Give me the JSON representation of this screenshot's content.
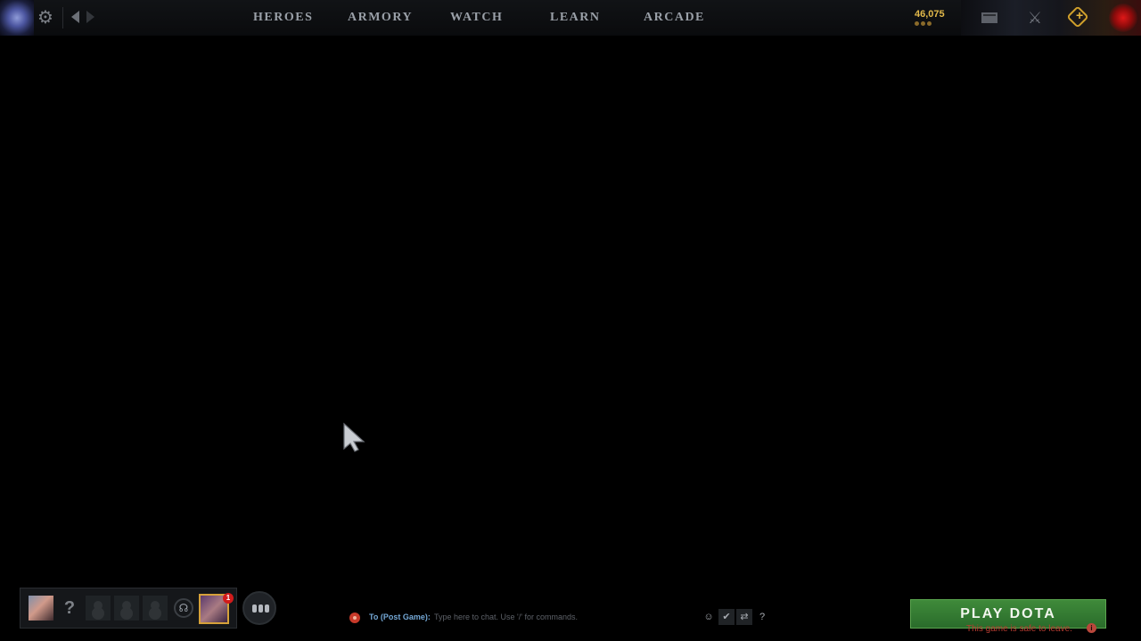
{
  "topbar": {
    "nav": [
      "HEROES",
      "ARMORY",
      "WATCH",
      "LEARN",
      "ARCADE"
    ],
    "shards": "46,075",
    "icons": {
      "dashboard": "dota-dashboard-icon",
      "settings": "gear-icon",
      "back": "chevron-left-icon",
      "forward": "chevron-right-icon",
      "mail": "mail-icon",
      "armory": "armory-icon",
      "plus": "plus-icon"
    }
  },
  "party": {
    "help_glyph": "?",
    "friend_badge": "1",
    "voice_glyph": "☊"
  },
  "chat": {
    "to_label": "To (Post Game):",
    "placeholder": "Type here to chat. Use '/' for commands.",
    "tools": [
      "☺",
      "✔",
      "⇄",
      "?"
    ]
  },
  "play": {
    "label": "PLAY DOTA",
    "status": "This game is safe to leave.",
    "info_glyph": "i",
    "button_color": "#3a7f37",
    "status_color": "#b93c31"
  }
}
